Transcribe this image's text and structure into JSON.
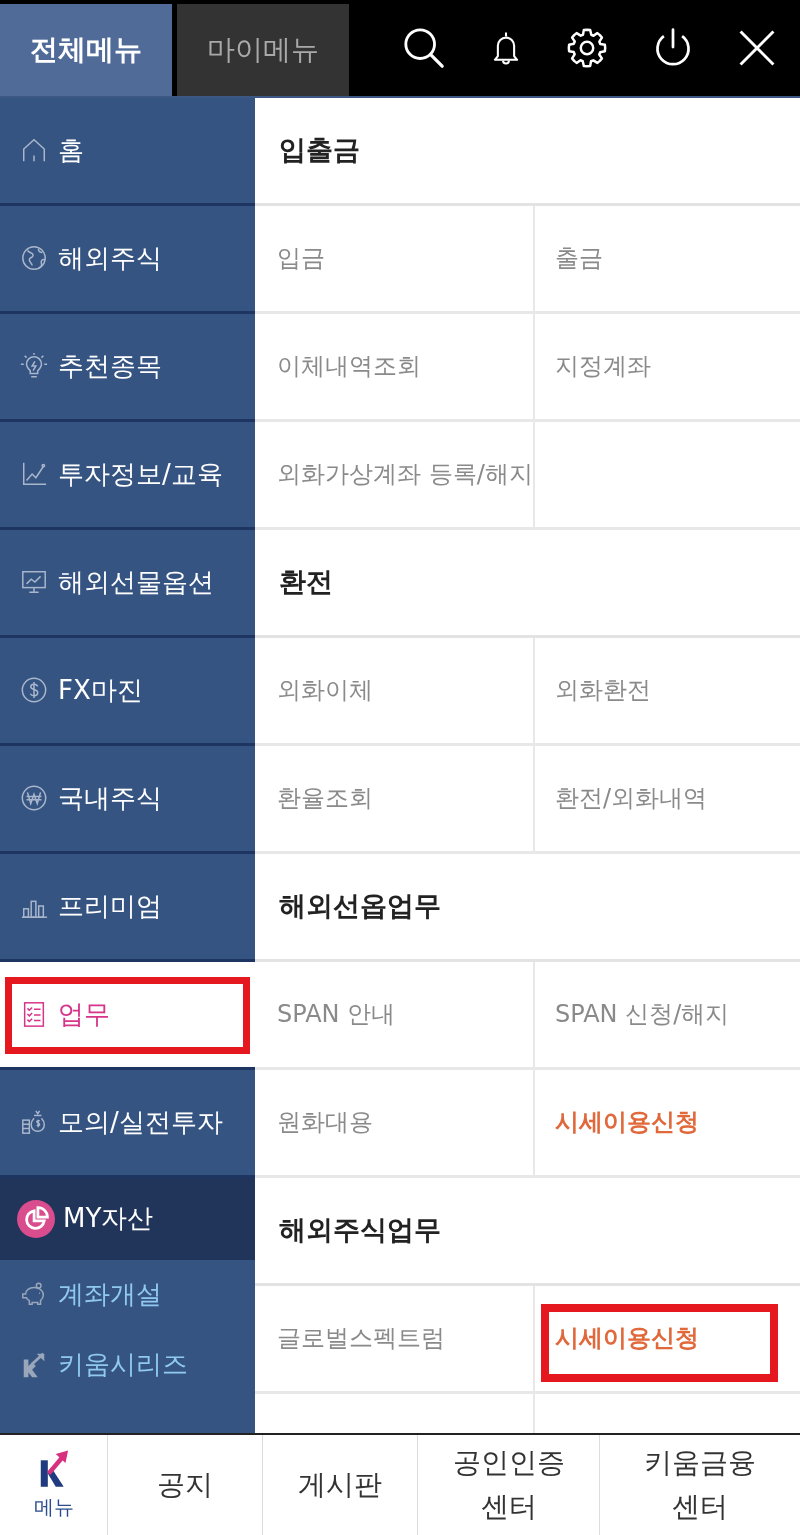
{
  "tabs": [
    {
      "label": "전체메뉴",
      "selected": true
    },
    {
      "label": "마이메뉴",
      "selected": false
    }
  ],
  "sidebar": {
    "items": [
      {
        "label": "홈",
        "kind": "menu",
        "selected": false,
        "marked": false
      },
      {
        "label": "해외주식",
        "kind": "menu",
        "selected": false,
        "marked": false
      },
      {
        "label": "추천종목",
        "kind": "menu",
        "selected": false,
        "marked": false
      },
      {
        "label": "투자정보/교육",
        "kind": "menu",
        "selected": false,
        "marked": false
      },
      {
        "label": "해외선물옵션",
        "kind": "menu",
        "selected": false,
        "marked": false
      },
      {
        "label": "FX마진",
        "kind": "menu",
        "selected": false,
        "marked": false
      },
      {
        "label": "국내주식",
        "kind": "menu",
        "selected": false,
        "marked": false
      },
      {
        "label": "프리미엄",
        "kind": "menu",
        "selected": false,
        "marked": false
      },
      {
        "label": "업무",
        "kind": "menu",
        "selected": true,
        "marked": true
      },
      {
        "label": "모의/실전투자",
        "kind": "menu",
        "selected": false,
        "marked": false
      },
      {
        "label": "MY자산",
        "kind": "asset",
        "selected": false,
        "marked": false
      },
      {
        "label": "계좌개설",
        "kind": "link",
        "selected": false,
        "marked": false
      },
      {
        "label": "키움시리즈",
        "kind": "link",
        "selected": false,
        "marked": false
      }
    ]
  },
  "sections": [
    {
      "title": "입출금",
      "items": [
        {
          "label": "입금",
          "emphasized": false,
          "marked": false
        },
        {
          "label": "출금",
          "emphasized": false,
          "marked": false
        },
        {
          "label": "이체내역조회",
          "emphasized": false,
          "marked": false
        },
        {
          "label": "지정계좌",
          "emphasized": false,
          "marked": false
        },
        {
          "label": "외화가상계좌 등록/해지",
          "emphasized": false,
          "marked": false
        }
      ]
    },
    {
      "title": "환전",
      "items": [
        {
          "label": "외화이체",
          "emphasized": false,
          "marked": false
        },
        {
          "label": "외화환전",
          "emphasized": false,
          "marked": false
        },
        {
          "label": "환율조회",
          "emphasized": false,
          "marked": false
        },
        {
          "label": "환전/외화내역",
          "emphasized": false,
          "marked": false
        }
      ]
    },
    {
      "title": "해외선옵업무",
      "items": [
        {
          "label": "SPAN 안내",
          "emphasized": false,
          "marked": false
        },
        {
          "label": "SPAN 신청/해지",
          "emphasized": false,
          "marked": false
        },
        {
          "label": "원화대용",
          "emphasized": false,
          "marked": false
        },
        {
          "label": "시세이용신청",
          "emphasized": true,
          "marked": false
        }
      ]
    },
    {
      "title": "해외주식업무",
      "items": [
        {
          "label": "글로벌스펙트럼",
          "emphasized": false,
          "marked": false
        },
        {
          "label": "시세이용신청",
          "emphasized": true,
          "marked": true
        }
      ]
    }
  ],
  "bottom_nav": [
    {
      "label": "메뉴",
      "kind": "logo"
    },
    {
      "label": "공지",
      "kind": "text"
    },
    {
      "label": "게시판",
      "kind": "text"
    },
    {
      "label": "공인인증 센터",
      "kind": "text"
    },
    {
      "label": "키움금융 센터",
      "kind": "text"
    }
  ]
}
